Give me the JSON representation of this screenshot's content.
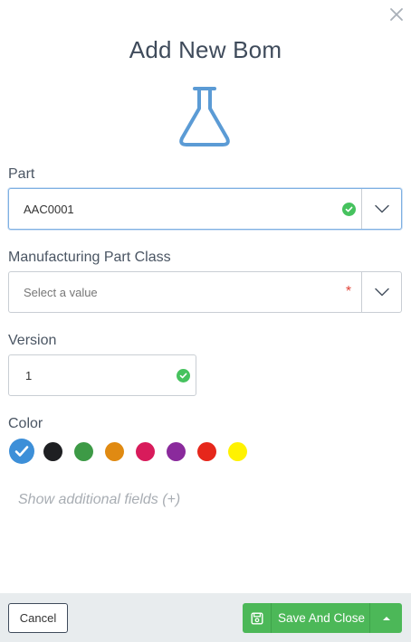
{
  "dialog": {
    "title": "Add New Bom"
  },
  "icons": {
    "close": "close-icon",
    "header": "flask-icon"
  },
  "fields": {
    "part": {
      "label": "Part",
      "value": "AAC0001",
      "status": "valid"
    },
    "manufacturing_part_class": {
      "label": "Manufacturing Part Class",
      "placeholder": "Select a value",
      "required": true
    },
    "version": {
      "label": "Version",
      "value": "1",
      "status": "valid"
    },
    "color": {
      "label": "Color",
      "selected": "#3d8fd8",
      "options": [
        "#3d8fd8",
        "#1e1f22",
        "#3d9a46",
        "#e08a12",
        "#d81b5b",
        "#8a2a9c",
        "#e6271b",
        "#fff200"
      ]
    }
  },
  "more_fields_link": "Show additional fields (+)",
  "footer": {
    "cancel_label": "Cancel",
    "save_label": "Save And Close"
  },
  "colors": {
    "accent_blue": "#5b9bd5",
    "success_green": "#4cb858",
    "footer_bg": "#e8ecee"
  }
}
